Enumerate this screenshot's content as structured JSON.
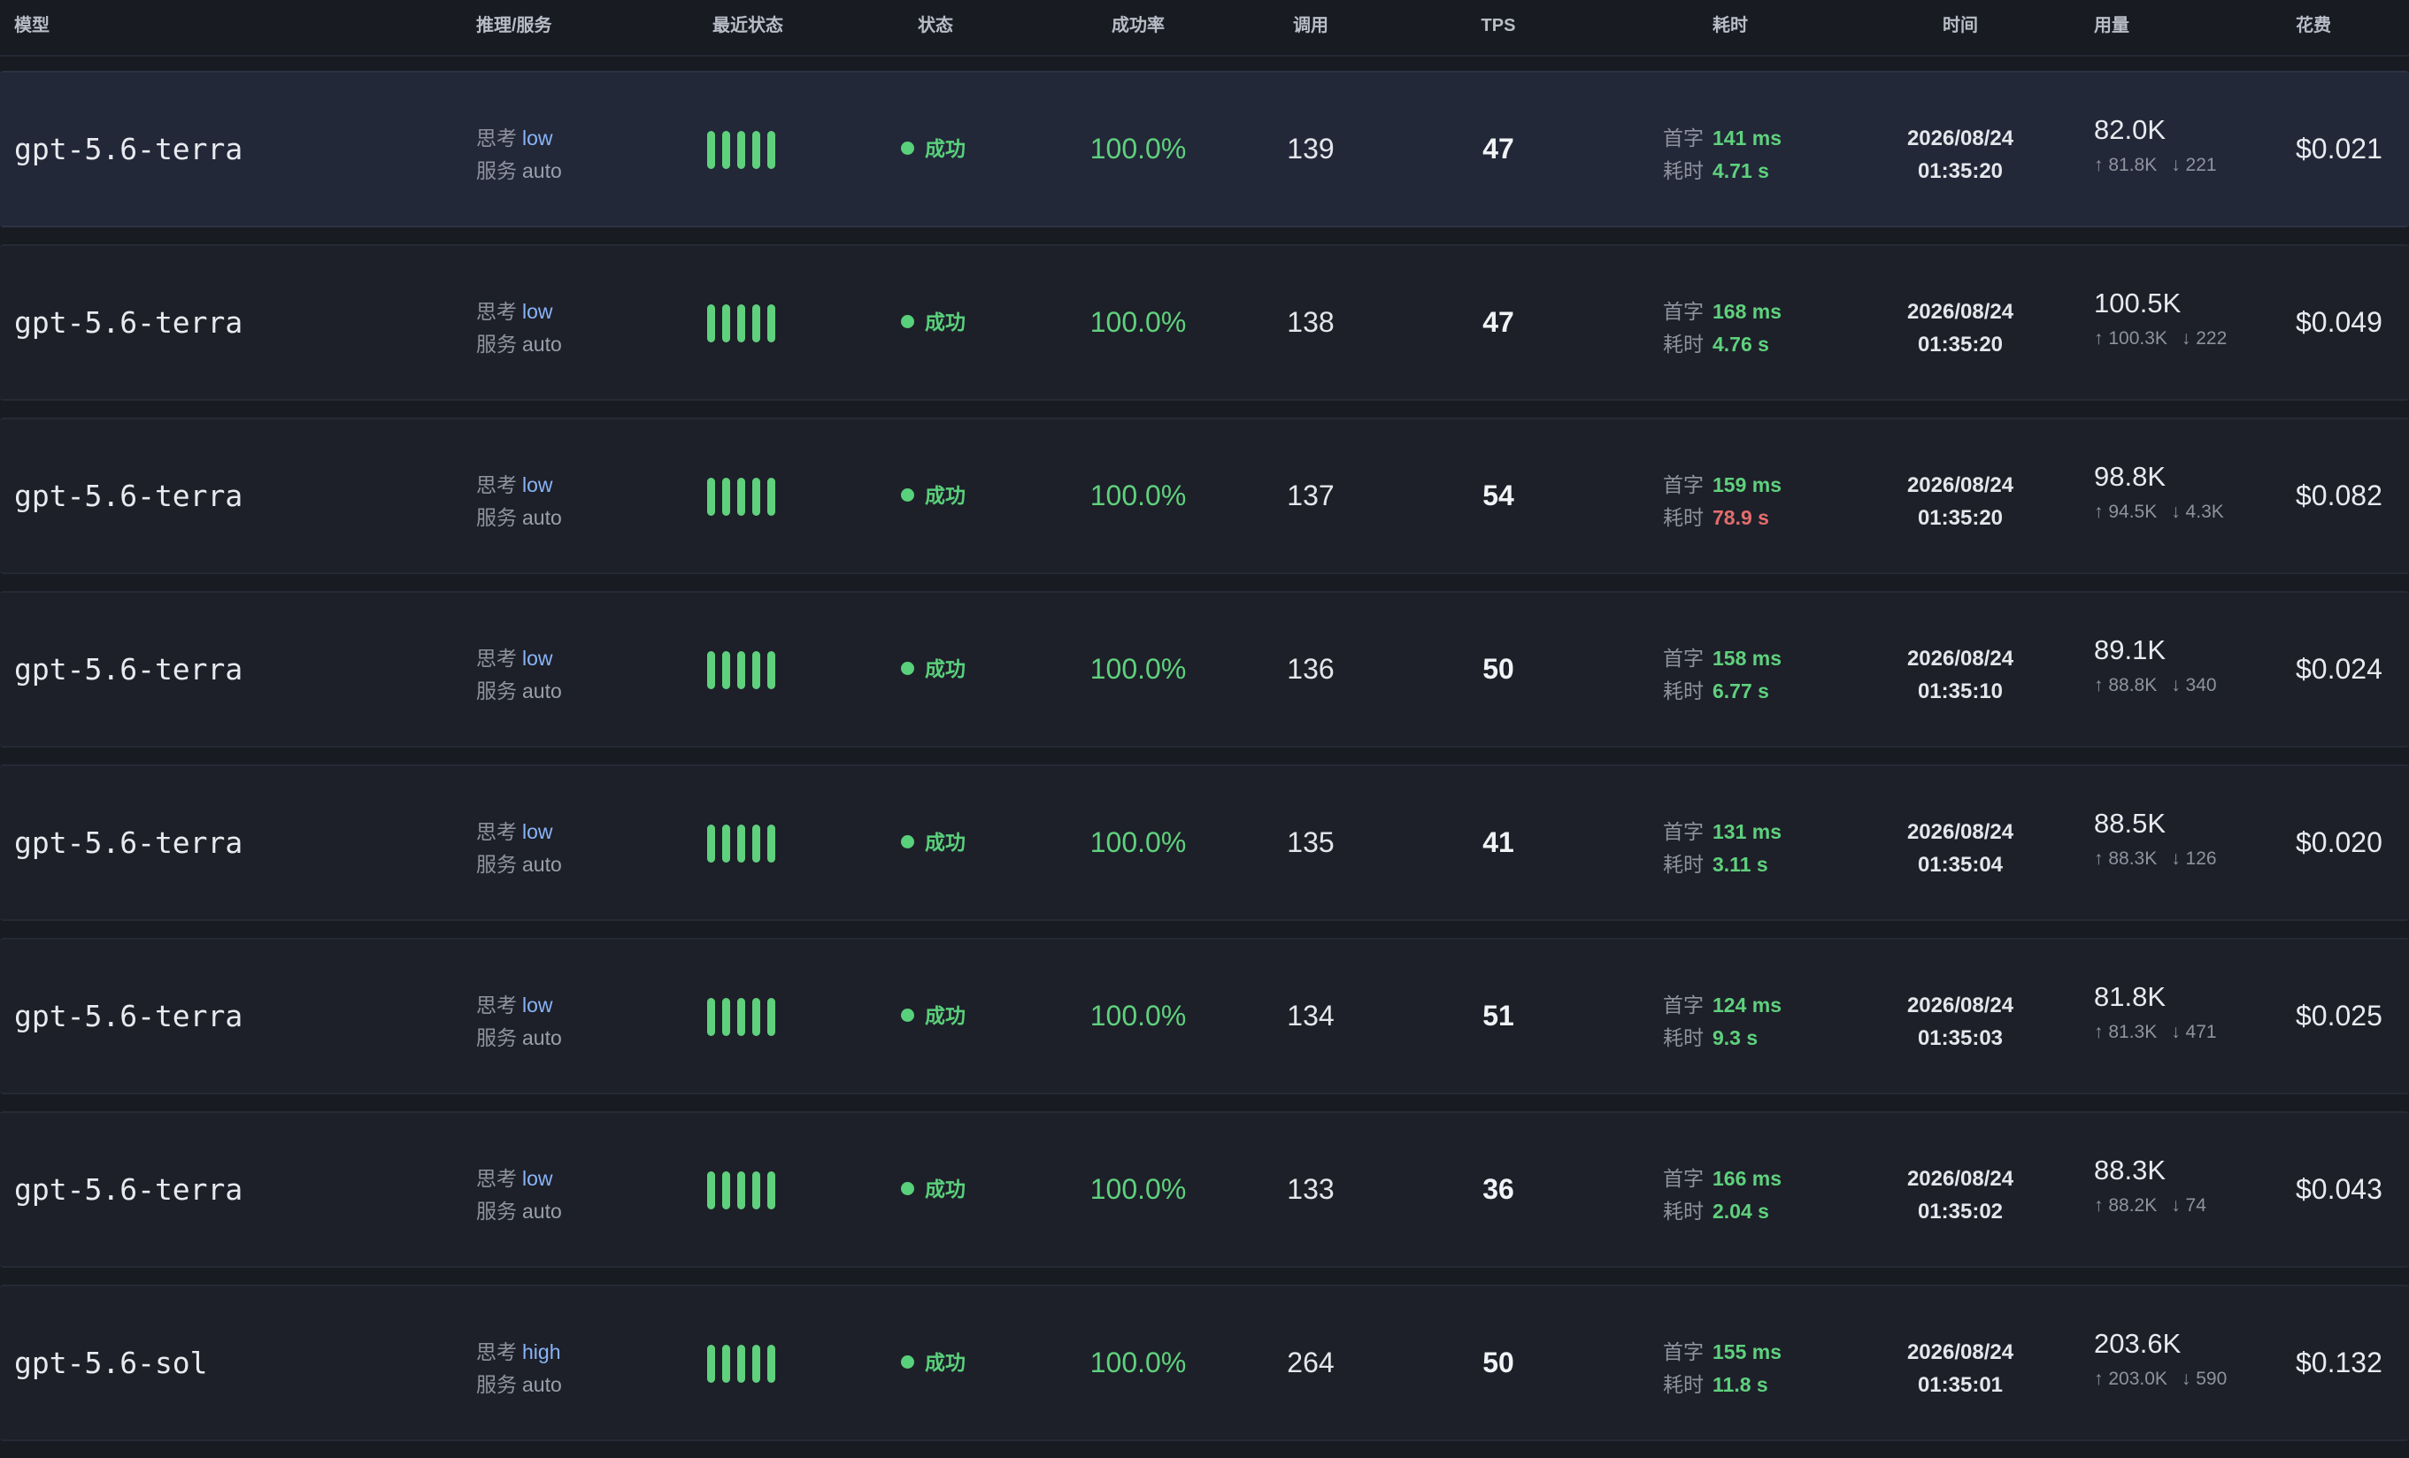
{
  "columns": {
    "model": "模型",
    "reasoning": "推理/服务",
    "recent_status": "最近状态",
    "status": "状态",
    "success_rate": "成功率",
    "calls": "调用",
    "tps": "TPS",
    "latency": "耗时",
    "time": "时间",
    "usage": "用量",
    "cost": "花费"
  },
  "labels": {
    "think": "思考",
    "service": "服务",
    "first_token": "首字",
    "duration": "耗时"
  },
  "colors": {
    "success": "#5fd17d",
    "slow": "#e36d6d",
    "link": "#8ab4f8"
  },
  "rows": [
    {
      "model": "gpt-5.6-terra",
      "think": "low",
      "service": "auto",
      "recent": [
        "success",
        "success",
        "success",
        "success",
        "success"
      ],
      "status": "成功",
      "rate": "100.0%",
      "calls": "139",
      "tps": "47",
      "first": "141 ms",
      "dur": "4.71 s",
      "dur_slow": false,
      "date": "2026/08/24",
      "clock": "01:35:20",
      "total": "82.0K",
      "in": "↑ 81.8K",
      "out": "↓ 221",
      "cost": "$0.021",
      "highlighted": true
    },
    {
      "model": "gpt-5.6-terra",
      "think": "low",
      "service": "auto",
      "recent": [
        "success",
        "success",
        "success",
        "success",
        "success"
      ],
      "status": "成功",
      "rate": "100.0%",
      "calls": "138",
      "tps": "47",
      "first": "168 ms",
      "dur": "4.76 s",
      "dur_slow": false,
      "date": "2026/08/24",
      "clock": "01:35:20",
      "total": "100.5K",
      "in": "↑ 100.3K",
      "out": "↓ 222",
      "cost": "$0.049",
      "highlighted": false
    },
    {
      "model": "gpt-5.6-terra",
      "think": "low",
      "service": "auto",
      "recent": [
        "success",
        "success",
        "success",
        "success",
        "success"
      ],
      "status": "成功",
      "rate": "100.0%",
      "calls": "137",
      "tps": "54",
      "first": "159 ms",
      "dur": "78.9 s",
      "dur_slow": true,
      "date": "2026/08/24",
      "clock": "01:35:20",
      "total": "98.8K",
      "in": "↑ 94.5K",
      "out": "↓ 4.3K",
      "cost": "$0.082",
      "highlighted": false
    },
    {
      "model": "gpt-5.6-terra",
      "think": "low",
      "service": "auto",
      "recent": [
        "success",
        "success",
        "success",
        "success",
        "success"
      ],
      "status": "成功",
      "rate": "100.0%",
      "calls": "136",
      "tps": "50",
      "first": "158 ms",
      "dur": "6.77 s",
      "dur_slow": false,
      "date": "2026/08/24",
      "clock": "01:35:10",
      "total": "89.1K",
      "in": "↑ 88.8K",
      "out": "↓ 340",
      "cost": "$0.024",
      "highlighted": false
    },
    {
      "model": "gpt-5.6-terra",
      "think": "low",
      "service": "auto",
      "recent": [
        "success",
        "success",
        "success",
        "success",
        "success"
      ],
      "status": "成功",
      "rate": "100.0%",
      "calls": "135",
      "tps": "41",
      "first": "131 ms",
      "dur": "3.11 s",
      "dur_slow": false,
      "date": "2026/08/24",
      "clock": "01:35:04",
      "total": "88.5K",
      "in": "↑ 88.3K",
      "out": "↓ 126",
      "cost": "$0.020",
      "highlighted": false
    },
    {
      "model": "gpt-5.6-terra",
      "think": "low",
      "service": "auto",
      "recent": [
        "success",
        "success",
        "success",
        "success",
        "success"
      ],
      "status": "成功",
      "rate": "100.0%",
      "calls": "134",
      "tps": "51",
      "first": "124 ms",
      "dur": "9.3 s",
      "dur_slow": false,
      "date": "2026/08/24",
      "clock": "01:35:03",
      "total": "81.8K",
      "in": "↑ 81.3K",
      "out": "↓ 471",
      "cost": "$0.025",
      "highlighted": false
    },
    {
      "model": "gpt-5.6-terra",
      "think": "low",
      "service": "auto",
      "recent": [
        "success",
        "success",
        "success",
        "success",
        "success"
      ],
      "status": "成功",
      "rate": "100.0%",
      "calls": "133",
      "tps": "36",
      "first": "166 ms",
      "dur": "2.04 s",
      "dur_slow": false,
      "date": "2026/08/24",
      "clock": "01:35:02",
      "total": "88.3K",
      "in": "↑ 88.2K",
      "out": "↓ 74",
      "cost": "$0.043",
      "highlighted": false
    },
    {
      "model": "gpt-5.6-sol",
      "think": "high",
      "service": "auto",
      "recent": [
        "success",
        "success",
        "success",
        "success",
        "success"
      ],
      "status": "成功",
      "rate": "100.0%",
      "calls": "264",
      "tps": "50",
      "first": "155 ms",
      "dur": "11.8 s",
      "dur_slow": false,
      "date": "2026/08/24",
      "clock": "01:35:01",
      "total": "203.6K",
      "in": "↑ 203.0K",
      "out": "↓ 590",
      "cost": "$0.132",
      "highlighted": false
    }
  ]
}
